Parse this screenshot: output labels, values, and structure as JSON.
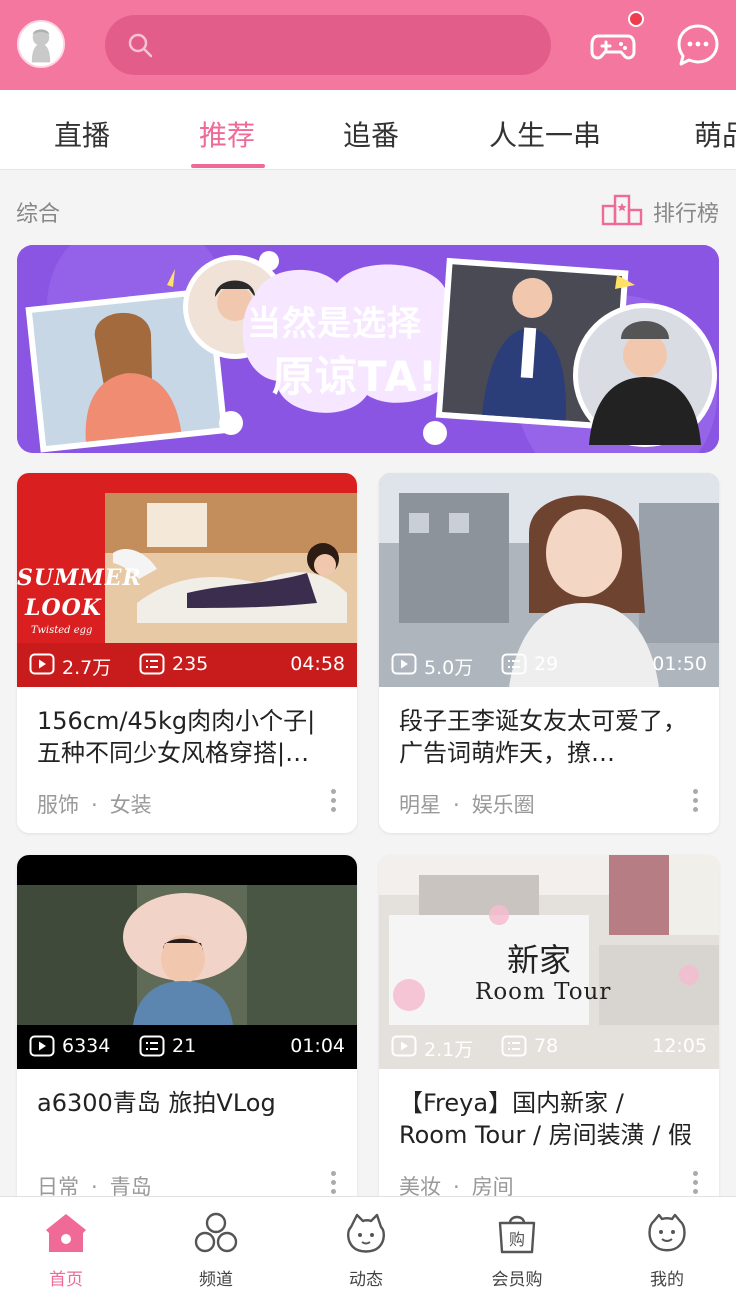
{
  "colors": {
    "brand": "#f4779f",
    "accent": "#f06a97"
  },
  "header": {
    "search_placeholder": "",
    "icons": [
      "avatar",
      "search-icon",
      "game-controller-icon",
      "message-icon"
    ]
  },
  "tabs": [
    {
      "label": "直播"
    },
    {
      "label": "推荐"
    },
    {
      "label": "追番"
    },
    {
      "label": "人生一串"
    },
    {
      "label": "萌品"
    }
  ],
  "active_tab": "推荐",
  "section": {
    "title": "综合",
    "ranking_label": "排行榜"
  },
  "banner": {
    "line1": "当然是选择",
    "line2": "原谅TA!",
    "page_count": 4,
    "active_page": 1
  },
  "cards": [
    {
      "thumb_text": [
        "SUMMER",
        "LOOK",
        "Twisted egg"
      ],
      "plays": "2.7万",
      "danmaku": "235",
      "duration": "04:58",
      "title": "156cm/45kg肉肉小个子|五种不同少女风格穿搭|…",
      "tag1": "服饰",
      "tag2": "女装"
    },
    {
      "thumb_text": [],
      "plays": "5.0万",
      "danmaku": "29",
      "duration": "01:50",
      "title": "段子王李诞女友太可爱了，广告词萌炸天，撩…",
      "tag1": "明星",
      "tag2": "娱乐圈"
    },
    {
      "thumb_text": [],
      "plays": "6334",
      "danmaku": "21",
      "duration": "01:04",
      "title": "a6300青岛 旅拍VLog",
      "tag1": "日常",
      "tag2": "青岛"
    },
    {
      "thumb_text": [
        "新家",
        "Room Tour"
      ],
      "plays": "2.1万",
      "danmaku": "78",
      "duration": "12:05",
      "title": "【Freya】国内新家 / Room Tour / 房间装潢 / 假北…",
      "tag1": "美妆",
      "tag2": "房间"
    }
  ],
  "bottom_nav": [
    {
      "label": "首页",
      "icon": "home-icon"
    },
    {
      "label": "频道",
      "icon": "channels-icon"
    },
    {
      "label": "动态",
      "icon": "activity-icon"
    },
    {
      "label": "会员购",
      "icon": "shop-bag-icon"
    },
    {
      "label": "我的",
      "icon": "profile-face-icon"
    }
  ]
}
